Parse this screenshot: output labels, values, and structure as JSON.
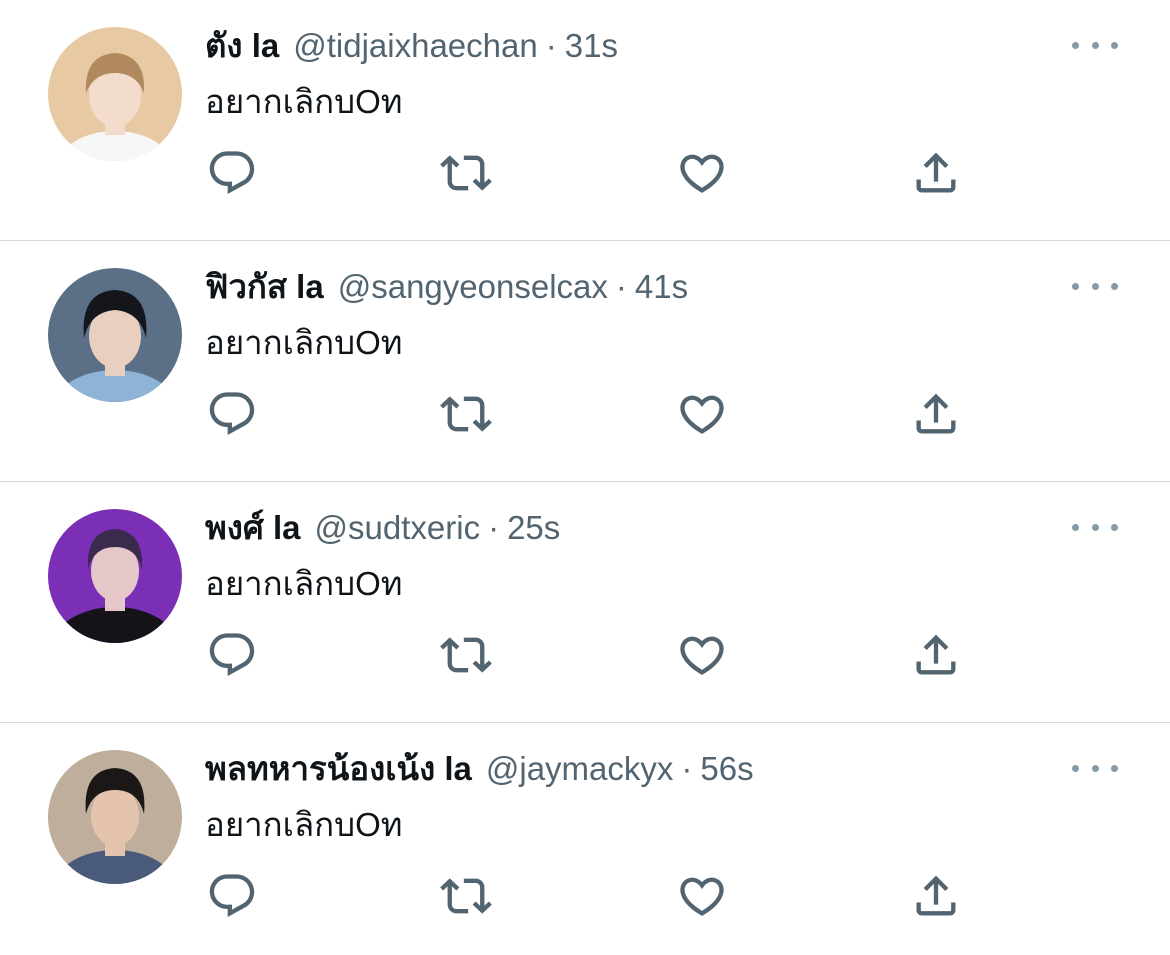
{
  "tweets": [
    {
      "display_name": "ตัง la",
      "handle": "@tidjaixhaechan",
      "separator": "·",
      "time": "31s",
      "text": "อยากเลิกบOท",
      "avatar": {
        "bg": "#e7c9a3",
        "hair": "#b08a5e",
        "skin": "#f3dccb",
        "shirt": "#f7f7f7"
      }
    },
    {
      "display_name": "ฟิวกัส la",
      "handle": "@sangyeonselcax",
      "separator": "·",
      "time": "41s",
      "text": "อยากเลิกบOท",
      "avatar": {
        "bg": "#5b6f86",
        "hair": "#14161c",
        "skin": "#e9cfc0",
        "shirt": "#8fb3d6"
      }
    },
    {
      "display_name": "พงศ์ la",
      "handle": "@sudtxeric",
      "separator": "·",
      "time": "25s",
      "text": "อยากเลิกบOท",
      "avatar": {
        "bg": "#7a2fb6",
        "hair": "#3a2a4e",
        "skin": "#e6c7c9",
        "shirt": "#151218"
      }
    },
    {
      "display_name": "พลทหารน้องเน้ง la",
      "handle": "@jaymackyx",
      "separator": "·",
      "time": "56s",
      "text": "อยากเลิกบOท",
      "avatar": {
        "bg": "#bfae9c",
        "hair": "#1a1716",
        "skin": "#e4c4ae",
        "shirt": "#4a5a7a"
      }
    }
  ],
  "icons": {
    "reply": "reply-icon",
    "retweet": "retweet-icon",
    "like": "like-icon",
    "share": "share-icon",
    "more": "more-icon"
  },
  "colors": {
    "icon": "#536471",
    "more_dots": "#8899a6",
    "divider": "#cfd9de",
    "text": "#0f1419",
    "secondary_text": "#536471"
  }
}
